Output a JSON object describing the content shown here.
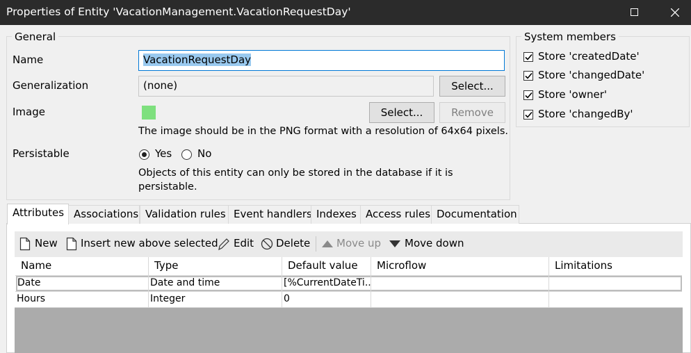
{
  "window": {
    "title": "Properties of Entity 'VacationManagement.VacationRequestDay'"
  },
  "general": {
    "legend": "General",
    "name_label": "Name",
    "name_value": "VacationRequestDay",
    "generalization_label": "Generalization",
    "generalization_value": "(none)",
    "generalization_select": "Select...",
    "image_label": "Image",
    "image_select": "Select...",
    "image_remove": "Remove",
    "image_hint": "The image should be in the PNG format with a resolution of 64x64 pixels.",
    "image_swatch_color": "#7ee07e",
    "persistable_label": "Persistable",
    "yes_label": "Yes",
    "no_label": "No",
    "persistable_selected": "Yes",
    "persistable_hint_line1": "Objects of this entity can only be stored in the database if it is",
    "persistable_hint_line2": "persistable."
  },
  "system_members": {
    "legend": "System members",
    "items": [
      {
        "label": "Store 'createdDate'",
        "checked": true
      },
      {
        "label": "Store 'changedDate'",
        "checked": true
      },
      {
        "label": "Store 'owner'",
        "checked": true
      },
      {
        "label": "Store 'changedBy'",
        "checked": true
      }
    ]
  },
  "tabs": [
    {
      "label": "Attributes",
      "active": true
    },
    {
      "label": "Associations"
    },
    {
      "label": "Validation rules"
    },
    {
      "label": "Event handlers"
    },
    {
      "label": "Indexes"
    },
    {
      "label": "Access rules"
    },
    {
      "label": "Documentation"
    }
  ],
  "toolbar": {
    "new_label": "New",
    "insert_label": "Insert new above selected",
    "edit_label": "Edit",
    "delete_label": "Delete",
    "move_up_label": "Move up",
    "move_down_label": "Move down"
  },
  "table": {
    "columns": [
      "Name",
      "Type",
      "Default value",
      "Microflow",
      "Limitations"
    ],
    "rows": [
      [
        "Date",
        "Date and time",
        "[%CurrentDateTi...",
        "",
        ""
      ],
      [
        "Hours",
        "Integer",
        "0",
        "",
        ""
      ]
    ]
  },
  "colors": {
    "selection": "#99c9ef",
    "focus_border": "#0078d7",
    "empty_area": "#ababab"
  }
}
